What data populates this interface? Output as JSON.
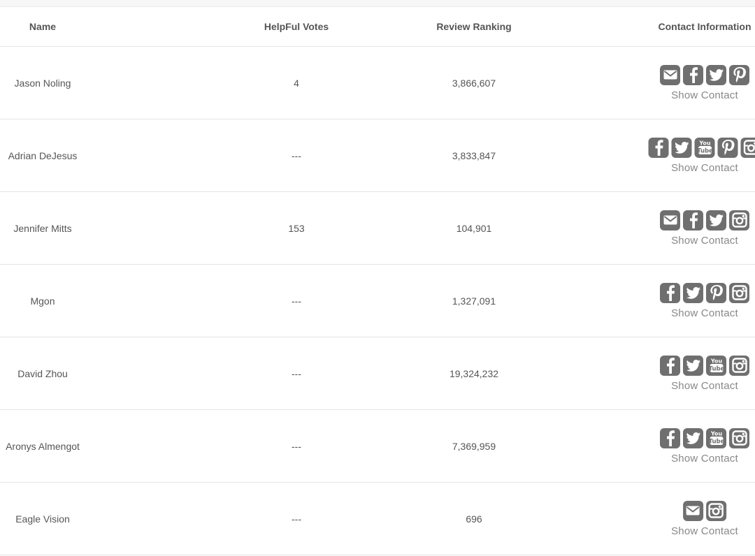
{
  "headers": {
    "name": "Name",
    "votes": "HelpFul Votes",
    "ranking": "Review Ranking",
    "contact": "Contact Information"
  },
  "show_contact_label": "Show Contact",
  "icon_color": "#6f6f6f",
  "rows": [
    {
      "name": "Jason Noling",
      "votes": "4",
      "ranking": "3,866,607",
      "icons": [
        "email-icon",
        "facebook-icon",
        "twitter-icon",
        "pinterest-icon"
      ]
    },
    {
      "name": "Adrian DeJesus",
      "votes": "---",
      "ranking": "3,833,847",
      "icons": [
        "facebook-icon",
        "twitter-icon",
        "youtube-icon",
        "pinterest-icon",
        "instagram-icon"
      ]
    },
    {
      "name": "Jennifer Mitts",
      "votes": "153",
      "ranking": "104,901",
      "icons": [
        "email-icon",
        "facebook-icon",
        "twitter-icon",
        "instagram-icon"
      ]
    },
    {
      "name": "Mgon",
      "votes": "---",
      "ranking": "1,327,091",
      "icons": [
        "facebook-icon",
        "twitter-icon",
        "pinterest-icon",
        "instagram-icon"
      ]
    },
    {
      "name": "David Zhou",
      "votes": "---",
      "ranking": "19,324,232",
      "icons": [
        "facebook-icon",
        "twitter-icon",
        "youtube-icon",
        "instagram-icon"
      ]
    },
    {
      "name": "Aronys Almengot",
      "votes": "---",
      "ranking": "7,369,959",
      "icons": [
        "facebook-icon",
        "twitter-icon",
        "youtube-icon",
        "instagram-icon"
      ]
    },
    {
      "name": "Eagle Vision",
      "votes": "---",
      "ranking": "696",
      "icons": [
        "email-icon",
        "instagram-icon"
      ]
    }
  ]
}
